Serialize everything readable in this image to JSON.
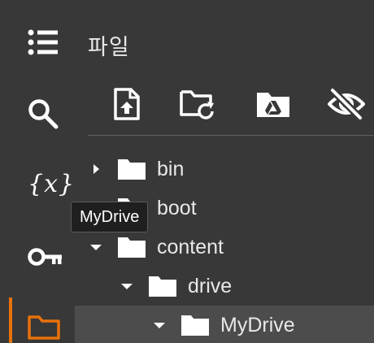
{
  "panel": {
    "title": "파일"
  },
  "rail": {
    "items": [
      {
        "name": "table-of-contents",
        "icon": "list-icon"
      },
      {
        "name": "search",
        "icon": "search-icon"
      },
      {
        "name": "variables",
        "icon": "variables-icon",
        "glyph": "{x}"
      },
      {
        "name": "secrets",
        "icon": "key-icon"
      },
      {
        "name": "files",
        "icon": "folder-icon",
        "active": true
      }
    ],
    "active_color": "#e8710a"
  },
  "toolbar": {
    "buttons": [
      {
        "name": "upload-to-session-storage",
        "icon": "file-upload-icon"
      },
      {
        "name": "refresh",
        "icon": "folder-refresh-icon"
      },
      {
        "name": "mount-drive",
        "icon": "drive-folder-icon"
      },
      {
        "name": "toggle-hidden-files",
        "icon": "eye-off-icon"
      }
    ]
  },
  "tree": {
    "nodes": [
      {
        "label": "bin",
        "expanded": false,
        "depth": 0
      },
      {
        "label": "boot",
        "expanded": false,
        "depth": 0
      },
      {
        "label": "content",
        "expanded": true,
        "depth": 0
      },
      {
        "label": "drive",
        "expanded": true,
        "depth": 1
      },
      {
        "label": "MyDrive",
        "expanded": true,
        "depth": 2,
        "selected": true
      }
    ]
  },
  "tooltip": {
    "text": "MyDrive"
  }
}
